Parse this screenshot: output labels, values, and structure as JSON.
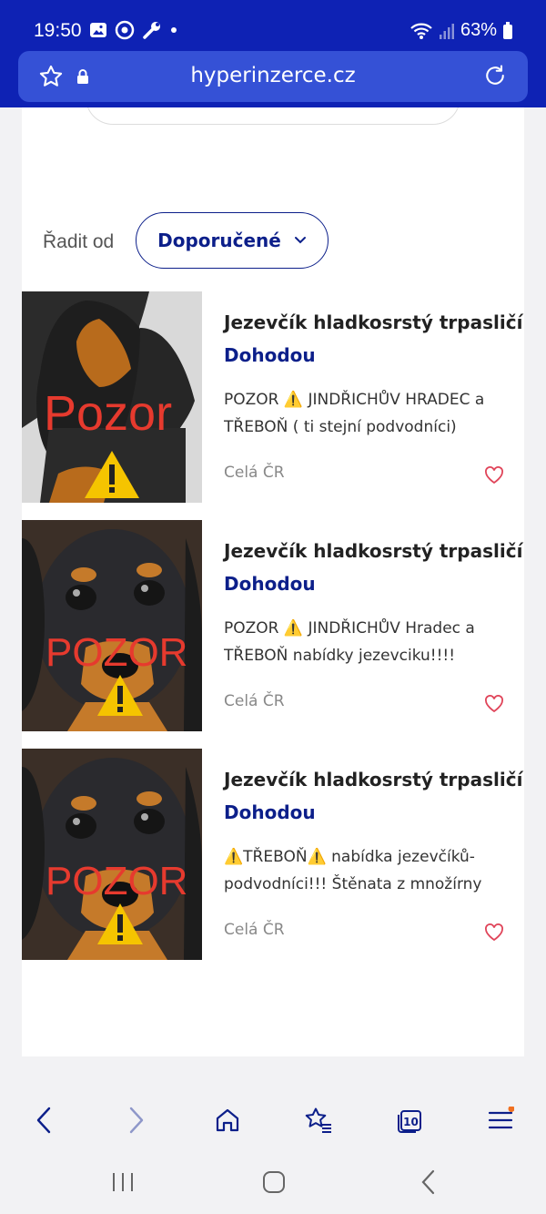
{
  "status": {
    "time": "19:50",
    "battery": "63%"
  },
  "browser": {
    "url": "hyperinzerce.cz",
    "tabs_count": "10"
  },
  "sort": {
    "label": "Řadit od",
    "value": "Doporučené"
  },
  "listings": [
    {
      "title": "Jezevčík hladkosrstý trpasličí",
      "price": "Dohodou",
      "desc": "POZOR ⚠️ JINDŘICHŮV HRADEC a TŘEBOŇ ( ti stejní podvodníci)",
      "location": "Celá ČR",
      "img_text": "Pozor"
    },
    {
      "title": "Jezevčík hladkosrstý trpasličí",
      "price": "Dohodou",
      "desc": "POZOR ⚠️ JINDŘICHŮV Hradec a TŘEBOŇ nabídky jezevciku!!!!",
      "location": "Celá ČR",
      "img_text": "POZOR"
    },
    {
      "title": "Jezevčík hladkosrstý trpasličí",
      "price": "Dohodou",
      "desc": "⚠️TŘEBOŇ⚠️ nabídka jezevčíků- podvodníci!!! Štěnata z množírny",
      "location": "Celá ČR",
      "img_text": "POZOR"
    }
  ],
  "colors": {
    "brand": "#0e22b4",
    "accent": "#0c1f8a",
    "heart": "#e0455a",
    "warning": "#f5c400"
  }
}
